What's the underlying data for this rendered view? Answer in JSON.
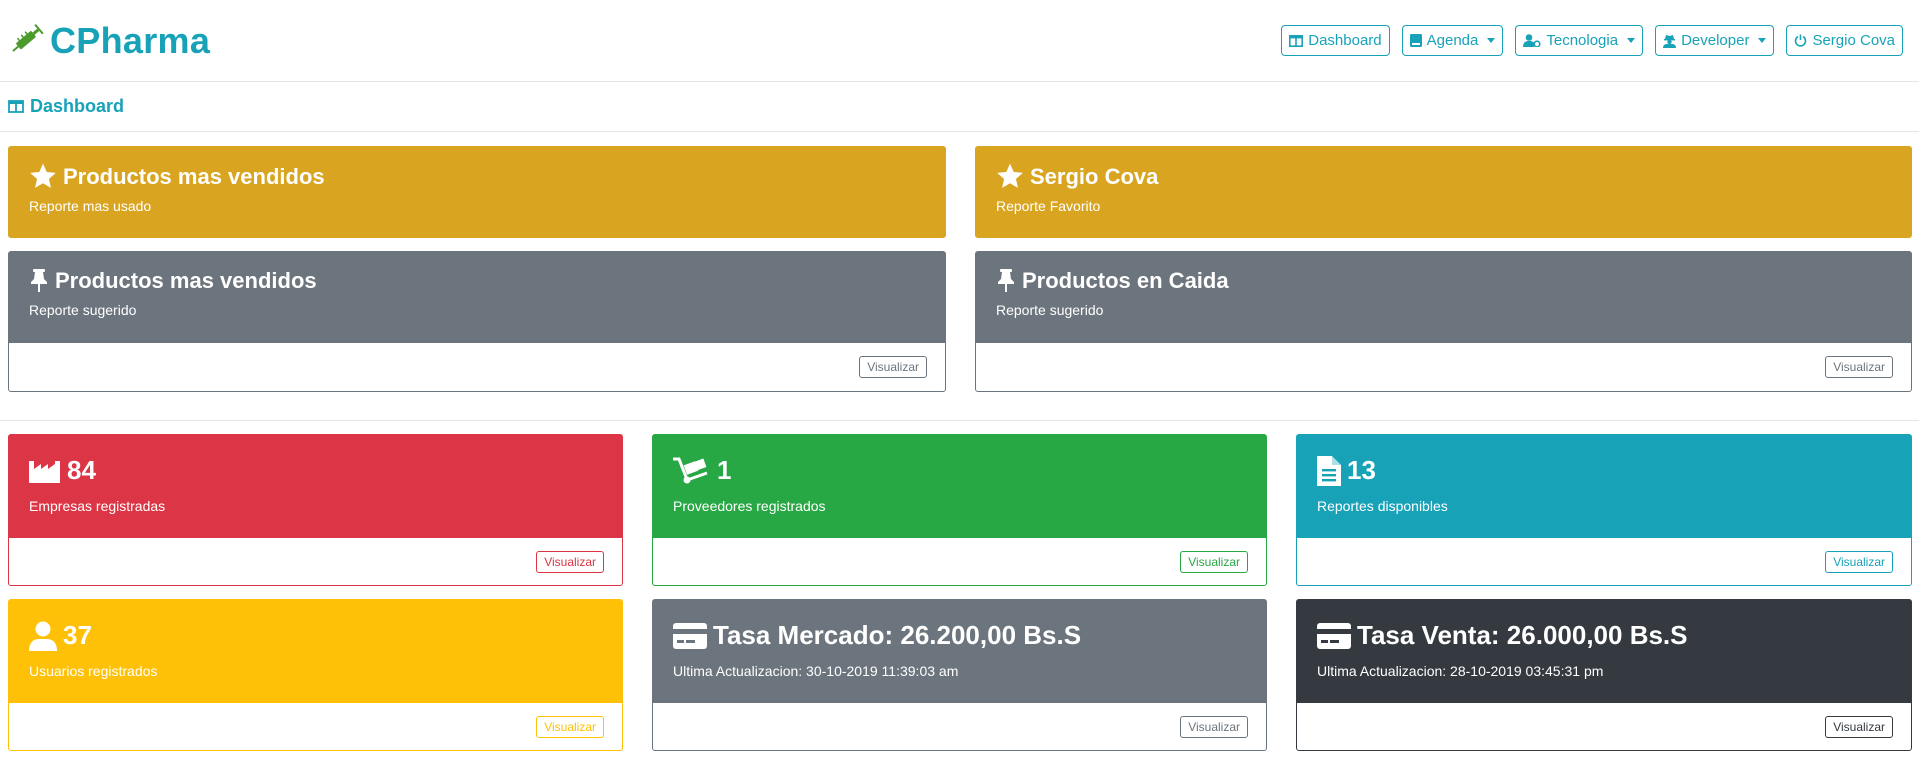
{
  "navbar": {
    "brand": "CPharma",
    "links": [
      {
        "label": "Dashboard",
        "icon": "columns-icon",
        "dropdown": false
      },
      {
        "label": "Agenda",
        "icon": "book-icon",
        "dropdown": true
      },
      {
        "label": "Tecnologia",
        "icon": "user-cog-icon",
        "dropdown": true
      },
      {
        "label": "Developer",
        "icon": "user-secret-icon",
        "dropdown": true
      },
      {
        "label": "Sergio Cova",
        "icon": "power-icon",
        "dropdown": false
      }
    ]
  },
  "breadcrumb": {
    "label": "Dashboard"
  },
  "favorites": [
    {
      "title": "Productos mas vendidos",
      "subtitle": "Reporte mas usado",
      "icon": "star-icon",
      "color": "#d9a521"
    },
    {
      "title": "Sergio Cova",
      "subtitle": "Reporte Favorito",
      "icon": "star-icon",
      "color": "#d9a521"
    }
  ],
  "suggested": [
    {
      "title": "Productos mas vendidos",
      "subtitle": "Reporte sugerido",
      "icon": "thumbtack-icon",
      "color": "#6c757d",
      "button": "Visualizar"
    },
    {
      "title": "Productos en Caida",
      "subtitle": "Reporte sugerido",
      "icon": "thumbtack-icon",
      "color": "#6c757d",
      "button": "Visualizar"
    }
  ],
  "stats": [
    {
      "value": "84",
      "label": "Empresas registradas",
      "icon": "industry-icon",
      "color": "#dc3545",
      "button": "Visualizar"
    },
    {
      "value": "1",
      "label": "Proveedores registrados",
      "icon": "dolly-icon",
      "color": "#28a745",
      "button": "Visualizar"
    },
    {
      "value": "13",
      "label": "Reportes disponibles",
      "icon": "file-icon",
      "color": "#17a2b8",
      "button": "Visualizar"
    },
    {
      "value": "37",
      "label": "Usuarios registrados",
      "icon": "user-icon",
      "color": "#ffc107",
      "button": "Visualizar"
    },
    {
      "value": "Tasa Mercado: 26.200,00 Bs.S",
      "label": "Ultima Actualizacion: 30-10-2019 11:39:03 am",
      "icon": "credit-card-icon",
      "color": "#6c757d",
      "button": "Visualizar"
    },
    {
      "value": "Tasa Venta: 26.000,00 Bs.S",
      "label": "Ultima Actualizacion: 28-10-2019 03:45:31 pm",
      "icon": "credit-card-icon",
      "color": "#343a40",
      "button": "Visualizar"
    }
  ]
}
